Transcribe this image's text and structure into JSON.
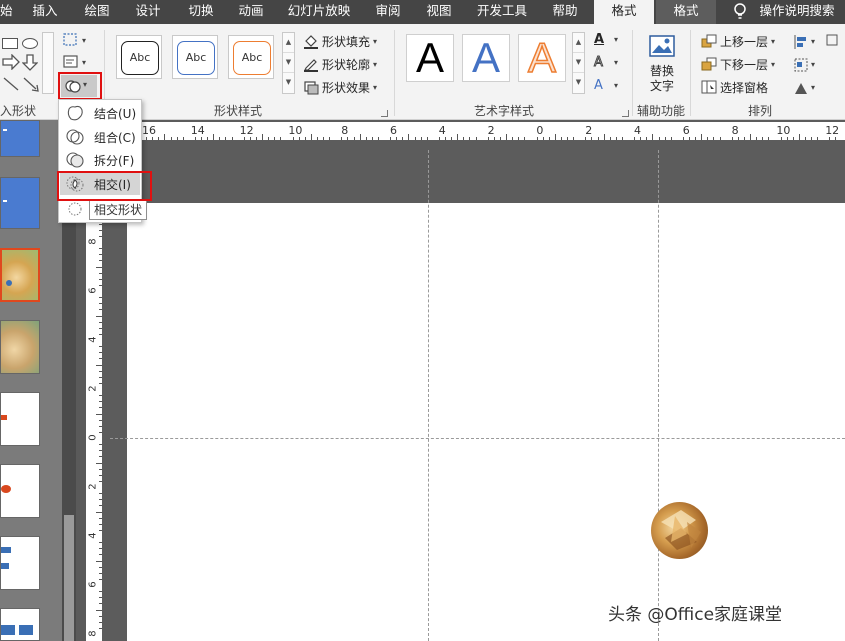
{
  "tabs": [
    {
      "label": "始",
      "active": false
    },
    {
      "label": "插入",
      "active": false
    },
    {
      "label": "绘图",
      "active": false
    },
    {
      "label": "设计",
      "active": false
    },
    {
      "label": "切换",
      "active": false
    },
    {
      "label": "动画",
      "active": false
    },
    {
      "label": "幻灯片放映",
      "active": false
    },
    {
      "label": "审阅",
      "active": false
    },
    {
      "label": "视图",
      "active": false
    },
    {
      "label": "开发工具",
      "active": false
    },
    {
      "label": "帮助",
      "active": false
    },
    {
      "label": "格式",
      "active": true
    },
    {
      "label": "格式",
      "active": false
    }
  ],
  "tell_me": "操作说明搜索",
  "ribbon": {
    "insert_shapes_label": "入形状",
    "shape_styles_label": "形状样式",
    "style_thumb_text": "Abc",
    "shape_fill": "形状填充",
    "shape_outline": "形状轮廓",
    "shape_effects": "形状效果",
    "wordart_label": "艺术字样式",
    "wordart_letter": "A",
    "alt_text_line1": "替换",
    "alt_text_line2": "文字",
    "accessibility_label": "辅助功能",
    "bring_forward": "上移一层",
    "send_backward": "下移一层",
    "selection_pane": "选择窗格",
    "arrange_label": "排列"
  },
  "merge_menu": {
    "items": [
      "结合(U)",
      "组合(C)",
      "拆分(F)",
      "相交(I)"
    ],
    "highlighted": "相交(I)",
    "tooltip": "相交形状"
  },
  "hruler_numbers": [
    "16",
    "14",
    "12",
    "10",
    "8",
    "6",
    "4",
    "2",
    "0",
    "2",
    "4",
    "6",
    "8",
    "10",
    "12"
  ],
  "vruler_numbers": [
    "8",
    "6",
    "4",
    "2",
    "0",
    "2",
    "4",
    "6",
    "8"
  ],
  "watermark": "头条 @Office家庭课堂",
  "colors": {
    "highlight_red": "#e01010",
    "active_tab": "#f3f3f3",
    "tab_bar": "#454545",
    "wordart_blue": "#4472c4",
    "wordart_orange": "#ed7d31"
  }
}
